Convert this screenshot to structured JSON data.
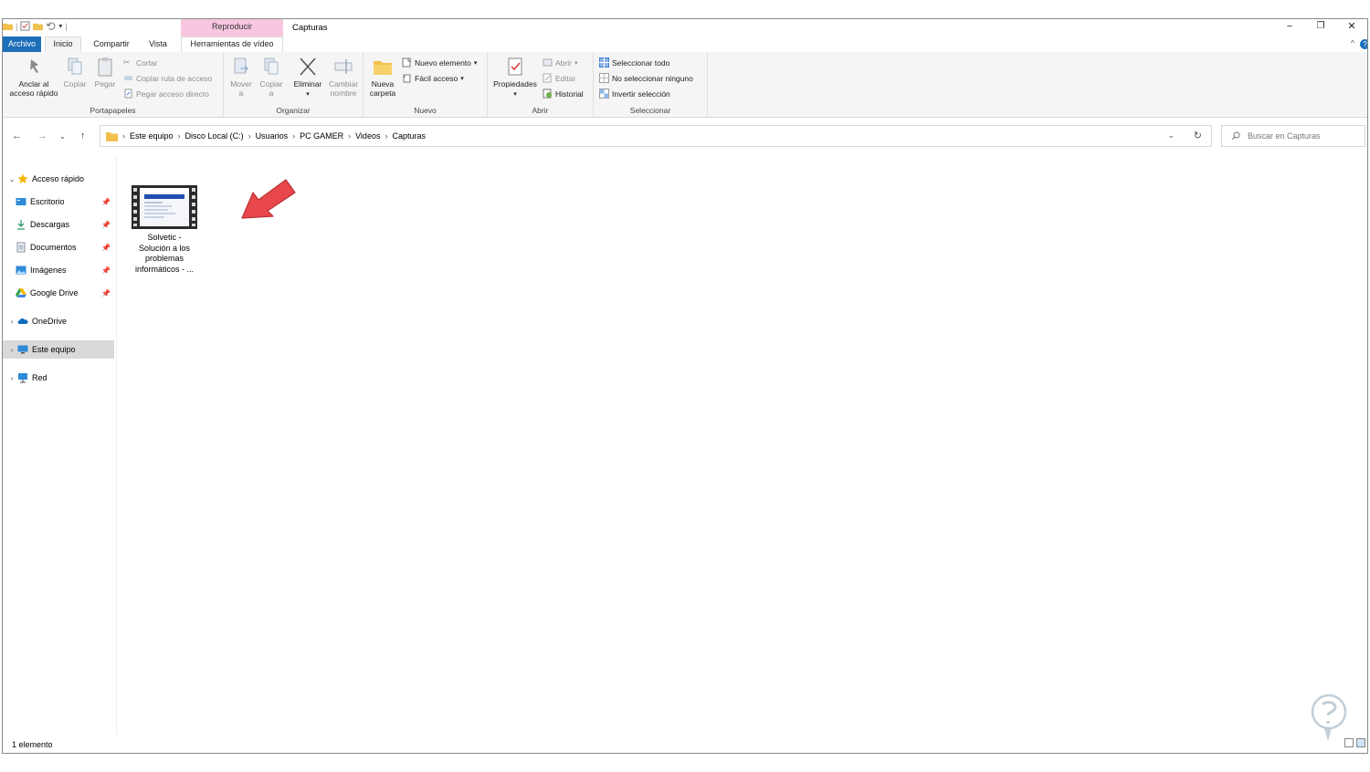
{
  "window": {
    "title": "Capturas",
    "context_tab_group": "Reproducir",
    "minimize": "−",
    "maximize": "❐",
    "close": "✕",
    "ribbon_toggle": "^",
    "help": "?"
  },
  "tabs": {
    "file": "Archivo",
    "home": "Inicio",
    "share": "Compartir",
    "view": "Vista",
    "video_tools": "Herramientas de vídeo"
  },
  "ribbon": {
    "clipboard": {
      "label": "Portapapeles",
      "pin": "Anclar al acceso rápido",
      "pin_l1": "Anclar al",
      "pin_l2": "acceso rápido",
      "copy": "Copiar",
      "paste": "Pegar",
      "cut": "Cortar",
      "copy_path": "Copiar ruta de acceso",
      "paste_shortcut": "Pegar acceso directo"
    },
    "organize": {
      "label": "Organizar",
      "move_l1": "Mover",
      "move_l2": "a",
      "copy_l1": "Copiar",
      "copy_l2": "a",
      "delete": "Eliminar",
      "rename_l1": "Cambiar",
      "rename_l2": "nombre"
    },
    "new": {
      "label": "Nuevo",
      "new_item": "Nuevo elemento",
      "easy_access": "Fácil acceso",
      "new_folder_l1": "Nueva",
      "new_folder_l2": "carpeta"
    },
    "open": {
      "label": "Abrir",
      "properties": "Propiedades",
      "open": "Abrir",
      "edit": "Editar",
      "history": "Historial"
    },
    "select": {
      "label": "Seleccionar",
      "select_all": "Seleccionar todo",
      "select_none": "No seleccionar ninguno",
      "invert": "Invertir selección"
    }
  },
  "address": {
    "crumbs": [
      "Este equipo",
      "Disco Local (C:)",
      "Usuarios",
      "PC GAMER",
      "Videos",
      "Capturas"
    ],
    "search_placeholder": "Buscar en Capturas"
  },
  "nav": {
    "quick_access": "Acceso rápido",
    "desktop": "Escritorio",
    "downloads": "Descargas",
    "documents": "Documentos",
    "pictures": "Imágenes",
    "google_drive": "Google Drive",
    "onedrive": "OneDrive",
    "this_pc": "Este equipo",
    "network": "Red"
  },
  "files": [
    {
      "name_l1": "Solvetic -",
      "name_l2": "Solución a los",
      "name_l3": "problemas",
      "name_l4": "informáticos - ..."
    }
  ],
  "status": {
    "count": "1 elemento"
  },
  "colors": {
    "accent": "#1e6fba",
    "context_tab": "#f8c6df",
    "arrow": "#e8484b",
    "selected_nav": "#d9d9d9"
  }
}
